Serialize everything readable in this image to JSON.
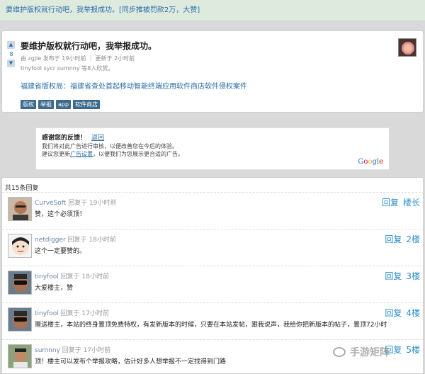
{
  "notice": "要维护版权就行动吧，我举报成功。[同步推被罚款2万，大赞]",
  "post": {
    "vote_up": "▲",
    "vote_count": "8",
    "vote_down": "▼",
    "title": "要维护版权就行动吧，我举报成功。",
    "meta": "由 zgjie 发布于 19小时前 ｜ 更新于 2小时前",
    "likes": "tinyfool sycr sumnny 等8人欣赏。",
    "link": "福建省版权局：福建省查处首起移动智能终端应用软件商店软件侵权案件",
    "tags": [
      "版权",
      "举报",
      "app",
      "软件商店"
    ]
  },
  "ad": {
    "title": "感谢您的反馈！",
    "back": "返回",
    "line1": "我们将对此广告进行审核，以便改善您在今后的体验。",
    "line2_before": "建议您更新",
    "settings": "广告设置",
    "line2_after": "，以便我们为您展示更合适的广告。",
    "brand": "Google",
    "brand_colors": [
      "#3369e8",
      "#d50f25",
      "#eeb211",
      "#3369e8",
      "#009925",
      "#d50f25"
    ]
  },
  "replies_header": "共15条回复",
  "replies": [
    {
      "user": "CurveSoft",
      "time": "回复于 19小时前",
      "text": "赞，这个必须顶！",
      "reply_label": "回复",
      "floor": "楼长"
    },
    {
      "user": "netdigger",
      "time": "回复于 18小时前",
      "text": "这个一定要赞的。",
      "reply_label": "回复",
      "floor": "2楼"
    },
    {
      "user": "tinyfool",
      "time": "回复于 18小时前",
      "text": "大爱楼主，赞",
      "reply_label": "回复",
      "floor": "3楼"
    },
    {
      "user": "tinyfool",
      "time": "回复于 17小时前",
      "text": "赠送楼主，本站的终身置顶免费特权，有发新版本的时候，只要在本站发帖，跟我说声，我给你把新版本的帖子，置顶72小时",
      "reply_label": "回复",
      "floor": "4楼"
    },
    {
      "user": "sumnny",
      "time": "回复于 17小时前",
      "text": "顶！楼主可以发布个举报攻略，估计好多人想举报不一定找得到门路",
      "reply_label": "回复",
      "floor": "5楼"
    }
  ],
  "watermark": "手游矩阵"
}
